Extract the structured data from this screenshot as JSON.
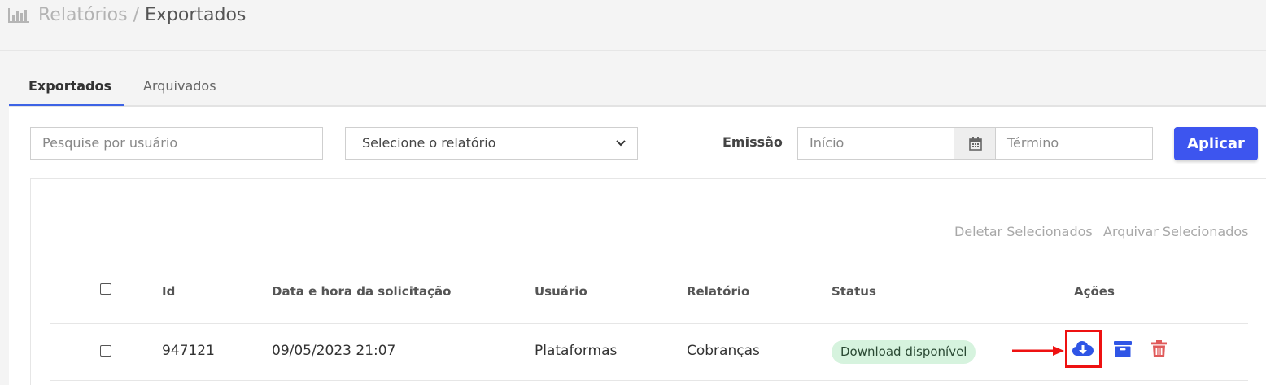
{
  "breadcrumb": {
    "parent": "Relatórios",
    "separator": " / ",
    "current": "Exportados",
    "icon": "bar-chart-icon"
  },
  "tabs": [
    {
      "label": "Exportados",
      "active": true
    },
    {
      "label": "Arquivados",
      "active": false
    }
  ],
  "filters": {
    "search_placeholder": "Pesquise por usuário",
    "report_select_value": "Selecione o relatório",
    "emission_label": "Emissão",
    "start_placeholder": "Início",
    "end_placeholder": "Término",
    "apply_label": "Aplicar"
  },
  "bulk_actions": {
    "delete_label": "Deletar Selecionados",
    "archive_label": "Arquivar Selecionados"
  },
  "table": {
    "columns": [
      "Id",
      "Data e hora da solicitação",
      "Usuário",
      "Relatório",
      "Status",
      "Ações"
    ],
    "rows": [
      {
        "id": "947121",
        "datetime": "09/05/2023 21:07",
        "user": "Plataformas",
        "report": "Cobranças",
        "status": "Download disponível",
        "actions": [
          "cloud-download-icon",
          "archive-icon",
          "trash-icon"
        ]
      }
    ]
  },
  "colors": {
    "accent": "#3d55ef",
    "status_bg": "#d6f3de",
    "delete": "#e05a5a",
    "annotation": "#ee1111"
  }
}
